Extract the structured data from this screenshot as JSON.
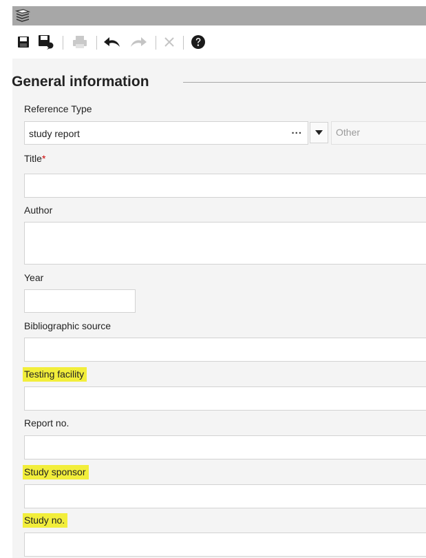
{
  "toolbar": {
    "icons": [
      "save-icon",
      "save-and-close-icon",
      "print-icon",
      "undo-icon",
      "redo-icon",
      "delete-icon",
      "help-icon"
    ]
  },
  "section": {
    "title": "General information"
  },
  "form": {
    "reference_type": {
      "label": "Reference Type",
      "value": "study report",
      "browse_label": "...",
      "other_placeholder": "Other"
    },
    "title": {
      "label": "Title",
      "required_mark": "*",
      "value": ""
    },
    "author": {
      "label": "Author",
      "value": ""
    },
    "year": {
      "label": "Year",
      "value": ""
    },
    "bibliographic_source": {
      "label": "Bibliographic source",
      "value": ""
    },
    "testing_facility": {
      "label": "Testing facility",
      "value": "",
      "highlighted": true
    },
    "report_no": {
      "label": "Report no.",
      "value": ""
    },
    "study_sponsor": {
      "label": "Study sponsor",
      "value": "",
      "highlighted": true
    },
    "study_no": {
      "label": "Study no.",
      "value": "",
      "highlighted": true
    }
  },
  "colors": {
    "highlight": "#f2ee3b",
    "required": "#cc0000",
    "title_bar": "#a7a7a7",
    "panel_bg": "#f4f4f4"
  }
}
